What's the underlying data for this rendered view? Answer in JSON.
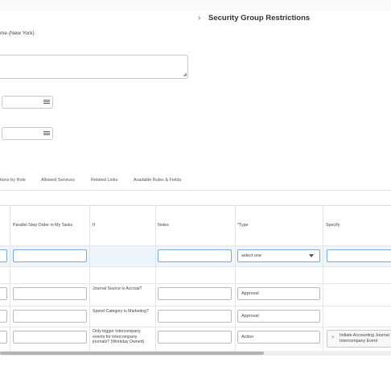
{
  "header": {
    "chevron": "›",
    "title": "Security Group Restrictions"
  },
  "form": {
    "timezone_text": "me (New York)",
    "textarea_value": ""
  },
  "tabs": [
    "tions by Role",
    "Allowed Services",
    "Related Links",
    "Available Rules & Fields"
  ],
  "grid": {
    "headers": {
      "parallel": "Parallel Step Order in My Tasks",
      "if": "If",
      "notes": "Notes",
      "type": "*Type",
      "specify": "Specify"
    },
    "select_placeholder": "select one",
    "rows": [
      {
        "if": "Journal Source is Accrual?",
        "type": "Approval"
      },
      {
        "if": "Spend Category is Marketing?",
        "type": "Approval"
      },
      {
        "if": "Only trigger Intercompany events for intercompany journals? (Workday Owned)",
        "type": "Action",
        "specify": "Initiate Accounting Journal Intercompany Event"
      }
    ]
  },
  "icons": {
    "list": "list-icon",
    "remove": "close-icon",
    "caret": "caret-down-icon"
  },
  "remove_glyph": "×"
}
